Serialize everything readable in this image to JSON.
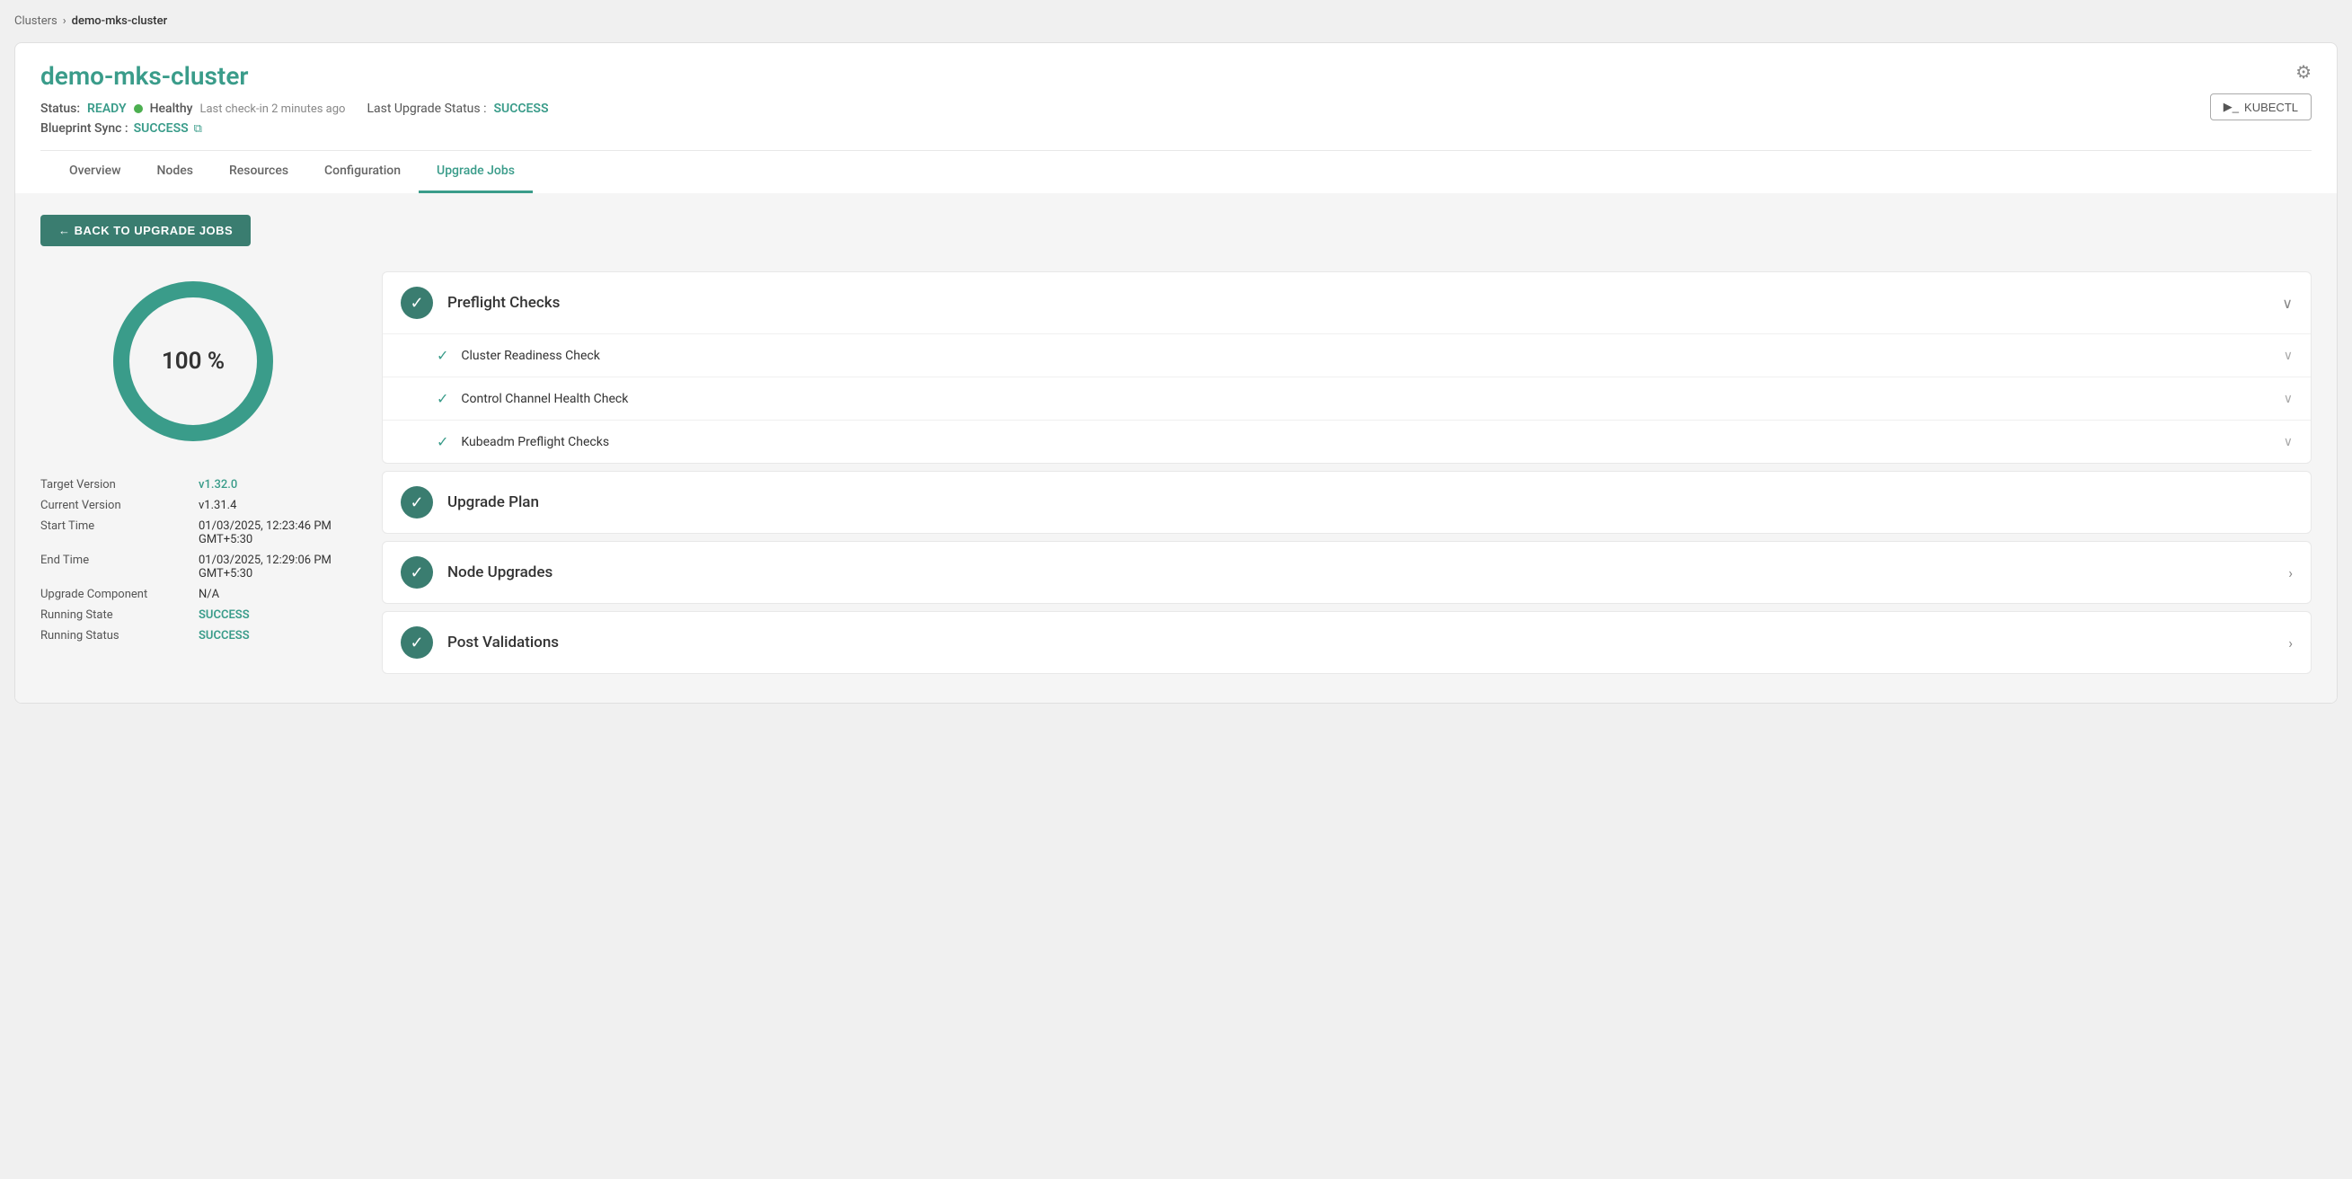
{
  "breadcrumb": {
    "clusters_label": "Clusters",
    "separator": "›",
    "current": "demo-mks-cluster"
  },
  "cluster": {
    "title": "demo-mks-cluster",
    "status_label": "Status:",
    "status_value": "READY",
    "health_dot_color": "#4caf50",
    "health_label": "Healthy",
    "checkin": "Last check-in 2 minutes ago",
    "upgrade_status_label": "Last Upgrade Status :",
    "upgrade_status_value": "SUCCESS",
    "blueprint_label": "Blueprint Sync :",
    "blueprint_value": "SUCCESS",
    "kubectl_label": "KUBECTL"
  },
  "tabs": [
    {
      "label": "Overview",
      "active": false
    },
    {
      "label": "Nodes",
      "active": false
    },
    {
      "label": "Resources",
      "active": false
    },
    {
      "label": "Configuration",
      "active": false
    },
    {
      "label": "Upgrade Jobs",
      "active": true
    }
  ],
  "back_button": "← BACK TO UPGRADE JOBS",
  "donut": {
    "percentage": "100 %",
    "value": 100,
    "stroke_color": "#3a9c8a",
    "track_color": "#e8e8e8",
    "radius": 80,
    "stroke_width": 18
  },
  "info": {
    "target_version_label": "Target Version",
    "target_version_value": "v1.32.0",
    "current_version_label": "Current Version",
    "current_version_value": "v1.31.4",
    "start_time_label": "Start Time",
    "start_time_value": "01/03/2025, 12:23:46 PM GMT+5:30",
    "end_time_label": "End Time",
    "end_time_value": "01/03/2025, 12:29:06 PM GMT+5:30",
    "component_label": "Upgrade Component",
    "component_value": "N/A",
    "running_state_label": "Running State",
    "running_state_value": "SUCCESS",
    "running_status_label": "Running Status",
    "running_status_value": "SUCCESS"
  },
  "steps": [
    {
      "id": "preflight",
      "title": "Preflight Checks",
      "expanded": true,
      "chevron": "∨",
      "children": [
        {
          "title": "Cluster Readiness Check",
          "chevron": "∨"
        },
        {
          "title": "Control Channel Health Check",
          "chevron": "∨"
        },
        {
          "title": "Kubeadm Preflight Checks",
          "chevron": "∨"
        }
      ]
    },
    {
      "id": "upgrade-plan",
      "title": "Upgrade Plan",
      "expanded": false,
      "chevron": ""
    },
    {
      "id": "node-upgrades",
      "title": "Node Upgrades",
      "expanded": false,
      "chevron": "›"
    },
    {
      "id": "post-validations",
      "title": "Post Validations",
      "expanded": false,
      "chevron": "›"
    }
  ]
}
